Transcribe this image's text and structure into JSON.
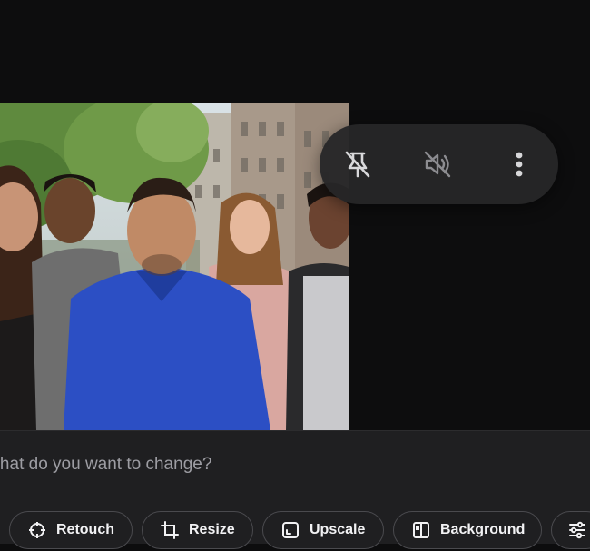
{
  "prompt": {
    "placeholder": "What do you want to change?",
    "visible_text": "t do you want to change?"
  },
  "media_toolbar": {
    "pin_icon": "pin-off-icon",
    "mute_icon": "volume-off-icon",
    "more_icon": "more-vertical-icon"
  },
  "chips": [
    {
      "label": "Retouch",
      "icon": "crosshair-icon"
    },
    {
      "label": "Resize",
      "icon": "crop-icon"
    },
    {
      "label": "Upscale",
      "icon": "expand-icon"
    },
    {
      "label": "Background",
      "icon": "background-split-icon"
    },
    {
      "label": "",
      "icon": "sliders-icon"
    }
  ],
  "colors": {
    "page_bg": "#0d0d0e",
    "panel_bg": "#1f1f21",
    "toolbar_bg": "#262628",
    "chip_border": "#4a4a4e",
    "placeholder_text": "#9d9da3",
    "shirt_blue": "#2c4fc4"
  }
}
